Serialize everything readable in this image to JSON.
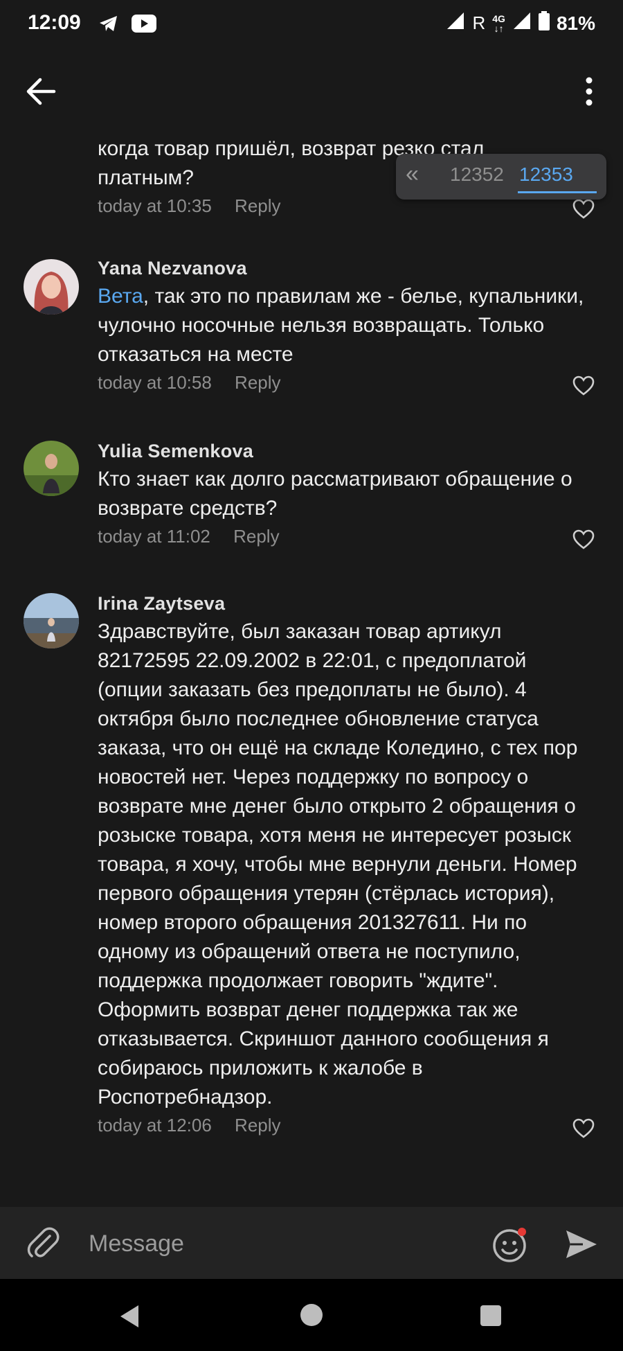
{
  "status_bar": {
    "time": "12:09",
    "network_indicator": "R",
    "network_type_top": "4G",
    "network_type_bottom": "↓↑",
    "battery": "81%",
    "icons": [
      "telegram-icon",
      "youtube-icon",
      "signal-icon",
      "wifi-icon",
      "battery-icon"
    ]
  },
  "app_bar": {
    "icons": [
      "back-arrow-icon",
      "more-vert-icon"
    ]
  },
  "pager": {
    "first_symbol": "«",
    "prev_page": "12352",
    "current_page": "12353"
  },
  "comments": [
    {
      "author": "",
      "text": "когда товар пришёл, возврат резко стал платным?",
      "time": "today at 10:35",
      "reply_label": "Reply"
    },
    {
      "author": "Yana Nezvanova",
      "mention": "Вета",
      "text": ", так это по правилам же - белье, купальники, чулочно носочные нельзя возвращать. Только отказаться на месте",
      "time": "today at 10:58",
      "reply_label": "Reply"
    },
    {
      "author": "Yulia Semenkova",
      "text": "Кто знает как долго рассматривают обращение о возврате средств?",
      "time": "today at 11:02",
      "reply_label": "Reply"
    },
    {
      "author": "Irina Zaytseva",
      "text": "Здравствуйте, был заказан товар артикул 82172595 22.09.2002 в 22:01, с предоплатой (опции заказать без предоплаты не было). 4 октября было последнее обновление статуса заказа, что он ещё на складе Коледино, с тех пор новостей нет. Через поддержку по вопросу о возврате мне денег было открыто 2 обращения о розыске товара, хотя меня не интересует розыск товара, я хочу, чтобы мне вернули деньги. Номер первого обращения утерян (стёрлась история), номер второго обращения 201327611. Ни по одному из обращений ответа не поступило, поддержка продолжает говорить \"ждите\". Оформить возврат денег поддержка так же отказывается. Скриншот данного сообщения я собираюсь приложить к жалобе в Роспотребнадзор.",
      "time": "today at 12:06",
      "reply_label": "Reply"
    }
  ],
  "composer": {
    "placeholder": "Message",
    "icons": [
      "paperclip-icon",
      "emoji-icon",
      "send-icon"
    ],
    "notification_dot_color": "#e53935"
  },
  "colors": {
    "background": "#191919",
    "accent": "#5aa8f0",
    "secondary_text": "#8f8f8f"
  }
}
